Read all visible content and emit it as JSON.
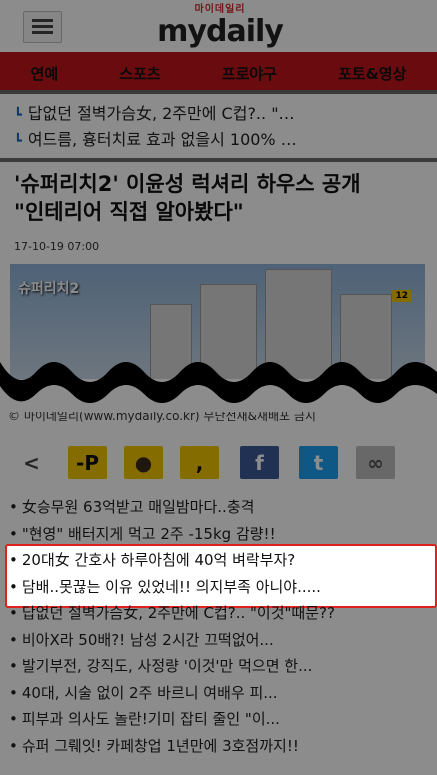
{
  "header": {
    "logo_sub": "마이데일리",
    "logo_main": "mydaily"
  },
  "nav": [
    "연예",
    "스포츠",
    "프로야구",
    "포토&영상"
  ],
  "ticker": [
    "답없던 절벽가슴女, 2주만에 C컵?.. \"…",
    "여드름, 흉터치료 효과 없을시 100% …"
  ],
  "article": {
    "title_line1": "'슈퍼리치2' 이윤성 럭셔리 하우스 공개",
    "title_line2": "\"인테리어 직접 알아봤다\"",
    "date": "17-10-19 07:00",
    "photo_logo": "슈퍼리치2",
    "photo_badge": "12",
    "credit": "© 마이데일리(www.mydaily.co.kr) 무단전재&재배포 금지"
  },
  "share": [
    {
      "name": "share-icon",
      "glyph": "<",
      "bg": "transparent",
      "fg": "#444"
    },
    {
      "name": "kakaopage-icon",
      "glyph": "-P",
      "bg": "#f2c500",
      "fg": "#111"
    },
    {
      "name": "kakaotalk-icon",
      "glyph": "●",
      "bg": "#f2c500",
      "fg": "#3a2a1a"
    },
    {
      "name": "kakaostory-icon",
      "glyph": ",",
      "bg": "#f2c500",
      "fg": "#111"
    },
    {
      "name": "facebook-icon",
      "glyph": "f",
      "bg": "#3b5998",
      "fg": "#fff"
    },
    {
      "name": "twitter-icon",
      "glyph": "t",
      "bg": "#1da1f2",
      "fg": "#fff"
    },
    {
      "name": "link-icon",
      "glyph": "∞",
      "bg": "#bdbdbd",
      "fg": "#555"
    }
  ],
  "list": [
    "女승무원 63억받고 매일밤마다..충격",
    "\"현영\" 배터지게 먹고 2주 -15kg 감량!!",
    "20대女 간호사 하루아침에 40억 벼락부자?",
    "담배..못끊는 이유 있었네!! 의지부족 아니야.....",
    "답없던 절벽가슴女, 2주만에 C컵?.. \"이것\"때문??",
    "비아X라 50배?! 남성 2시간 끄떡없어...",
    "발기부전, 강직도, 사정량 '이것'만 먹으면 한...",
    "40대, 시술 없이 2주 바르니 여배우 피...",
    "피부과 의사도 놀란!기미 잡티 줄인 \"이...",
    "슈퍼 그뤠잇! 카페창업 1년만에 3호점까지!!"
  ],
  "colors": {
    "nav_red": "#c2161c",
    "highlight": "#e12020",
    "bullet_blue": "#1e63c4"
  }
}
